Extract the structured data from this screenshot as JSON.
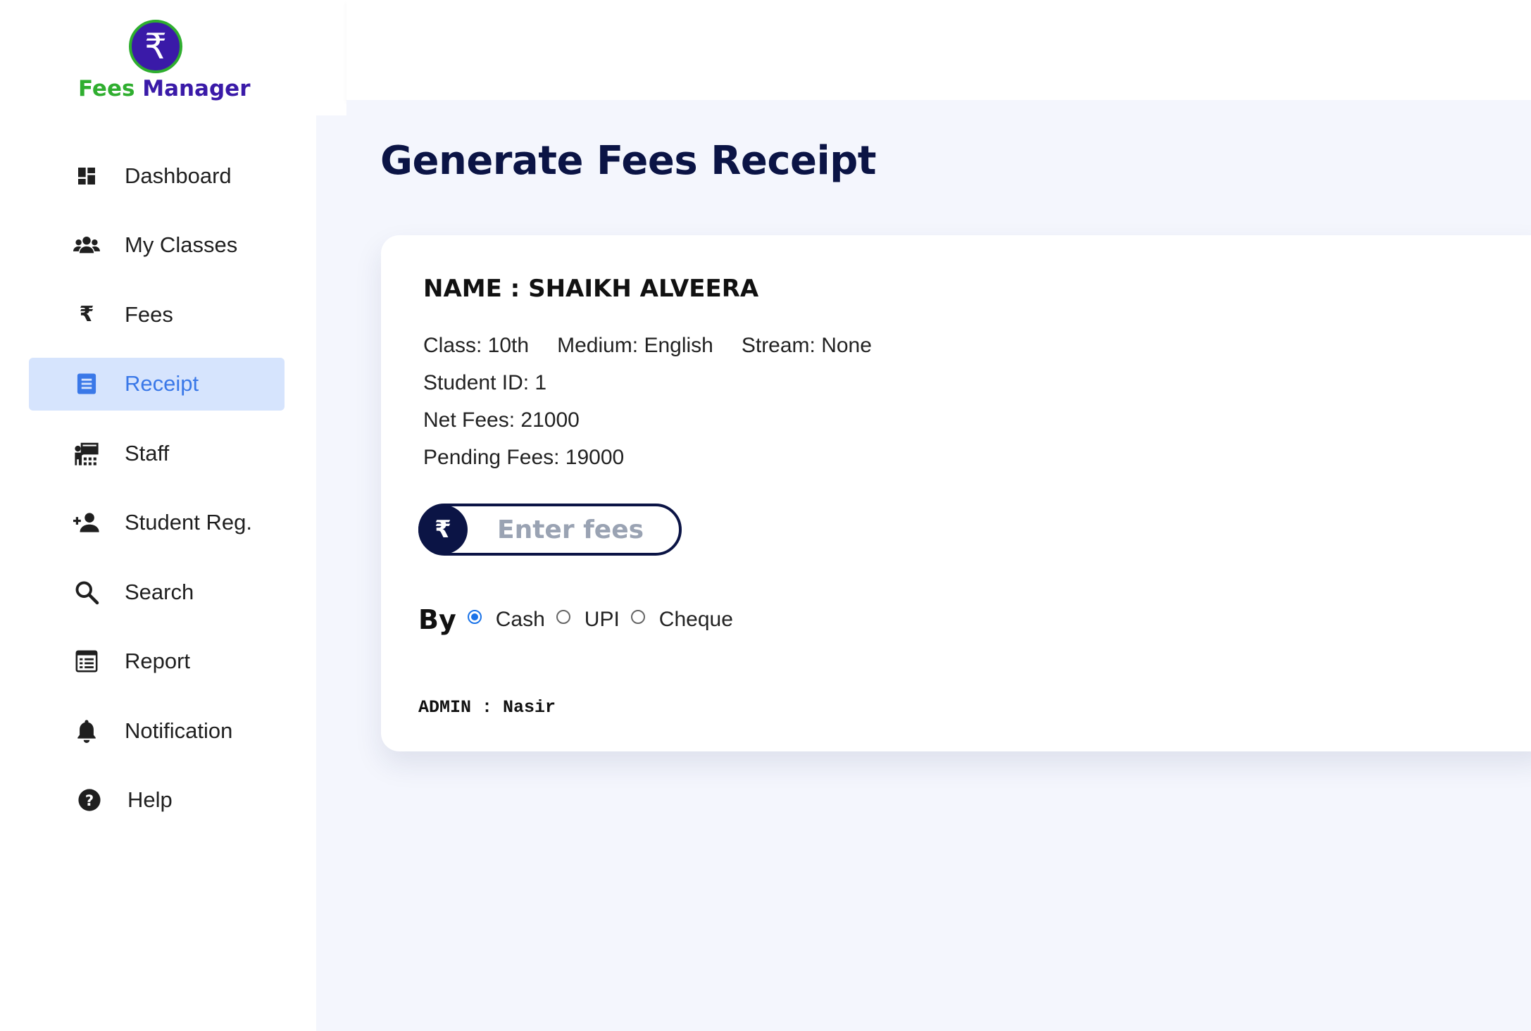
{
  "app": {
    "logo_symbol": "₹",
    "name_part1": "Fees",
    "name_part2": "Manager"
  },
  "sidebar": {
    "items": [
      {
        "label": "Dashboard",
        "icon": "dashboard-icon"
      },
      {
        "label": "My Classes",
        "icon": "users-group-icon"
      },
      {
        "label": "Fees",
        "icon": "rupee-icon"
      },
      {
        "label": "Receipt",
        "icon": "receipt-icon",
        "active": true
      },
      {
        "label": "Staff",
        "icon": "staff-presentation-icon"
      },
      {
        "label": "Student Reg.",
        "icon": "person-add-icon"
      },
      {
        "label": "Search",
        "icon": "search-icon"
      },
      {
        "label": "Report",
        "icon": "report-icon"
      },
      {
        "label": "Notification",
        "icon": "bell-icon"
      },
      {
        "label": "Help",
        "icon": "help-icon"
      }
    ]
  },
  "page": {
    "title": "Generate Fees Receipt"
  },
  "student": {
    "name_line": "NAME : SHAIKH ALVEERA",
    "class": "Class: 10th",
    "medium": "Medium: English",
    "stream": "Stream: None",
    "student_id": "Student ID: 1",
    "net_fees": "Net Fees: 21000",
    "pending_fees": "Pending Fees: 19000"
  },
  "fees_input": {
    "symbol": "₹",
    "placeholder": "Enter fees",
    "value": ""
  },
  "payment": {
    "label": "By",
    "options": [
      {
        "label": "Cash",
        "checked": true
      },
      {
        "label": "UPI",
        "checked": false
      },
      {
        "label": "Cheque",
        "checked": false
      }
    ]
  },
  "admin": {
    "text": "ADMIN : Nasir"
  },
  "colors": {
    "brand_green": "#2fae2f",
    "brand_purple": "#3a1aa8",
    "navy": "#0b1445",
    "active_bg": "#d6e4fd",
    "active_text": "#3a78e8",
    "radio_blue": "#1a73e8"
  }
}
